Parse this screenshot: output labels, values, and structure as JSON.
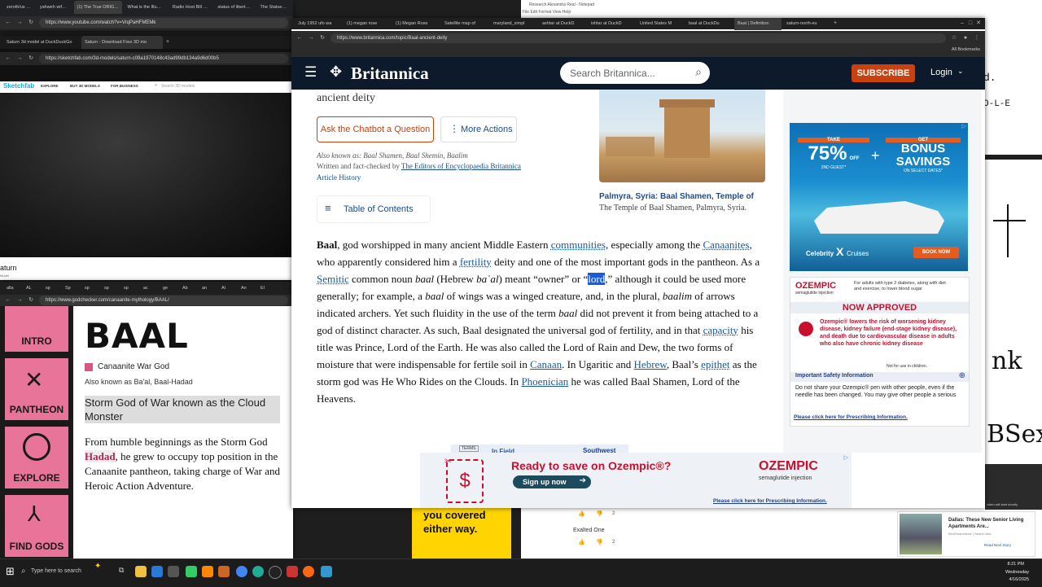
{
  "yt": {
    "tabs": [
      "zeroth/us - YouTube",
      "yahweh wife - YouTube",
      "(1) The True ORIGIN of God",
      "What is the Illuminati? Expo",
      "Radio Host Bill Cooper Pred",
      "status of liberty given by fre",
      "The Statue of Liberty and"
    ],
    "url": "https://www.youtube.com/watch?v=VrqPaHFMEMk"
  },
  "notepad": {
    "title": "Research Alexandra Real - Notepad",
    "menu": "File  Edit  Format  View  Help",
    "right_text": [
      "d.",
      "O-L-E"
    ]
  },
  "sf": {
    "tabs": [
      "Saturn 3d model at DuckDuckGo",
      "Saturn - Download Free 3D mo"
    ],
    "url": "https://sketchfab.com/3d-models/saturn-c09a1970148c43ad99db134a9d6d00b5",
    "logo": "Sketchfab",
    "nav": [
      "EXPLORE",
      "BUY 3D MODELS",
      "FOR BUSINESS"
    ],
    "search_placeholder": "Search 3D models",
    "title": "aturn",
    "subtitle": "Model"
  },
  "gc": {
    "tabs": [
      "alla",
      "AL",
      "sp",
      "Sp",
      "sp",
      "sp",
      "sp",
      "ac",
      "ge",
      "Ab",
      "an",
      "Al",
      "An",
      "El"
    ],
    "url": "https://www.godchecker.com/canaanite-mythology/BAAL/",
    "side": [
      "INTRO",
      "PANTHEON",
      "EXPLORE",
      "FIND GODS"
    ],
    "heading": "BAAL",
    "category": "Canaanite War God",
    "aka": "Also known as Ba'al, Baal-Hadad",
    "tagline": "Storm God of War known as the Cloud Monster",
    "body_pre": "From humble beginnings as the Storm God",
    "body_link": "Hadad",
    "body_post": ", he grew to occupy top position in the Canaanite pantheon, taking charge of War and Heroic Action Adventure."
  },
  "br": {
    "tabs": [
      "July 1952 ufo wa",
      "(1) megan rose",
      "(1) Megan Rose",
      "Satellite map of",
      "maryland_simpl",
      "ashtar at DuckD",
      "ishtar at DuckD",
      "United States M",
      "baal at DuckDu",
      "Baal | Definition",
      "saturn-north-eu"
    ],
    "url": "https://www.britannica.com/topic/Baal-ancient-deity",
    "bookmarks": "All Bookmarks",
    "logo": "Britannica",
    "search_placeholder": "Search Britannica...",
    "subscribe": "SUBSCRIBE",
    "login": "Login",
    "subtitle": "ancient deity",
    "chatbot": "Ask the Chatbot a Question",
    "more": "More Actions",
    "aka": "Also known as: Baal Shamen, Baal Shemin, Baalim",
    "written": "Written and fact-checked by ",
    "editors": "The Editors of Encyclopaedia Britannica",
    "history": "Article History",
    "toc": "Table of Contents",
    "caption_title": "Palmyra, Syria: Baal Shamen, Temple of",
    "caption_text": "The Temple of Baal Shamen, Palmyra, Syria.",
    "ad_terms": "TERMS",
    "ad_infield": "In Field",
    "ad_southwest": "Southwest"
  },
  "ad1": {
    "take": "TAKE",
    "pct": "75%",
    "off": "OFF",
    "guest": "2ND GUEST*",
    "get": "GET",
    "bonus": "BONUS",
    "savings": "SAVINGS",
    "select": "ON SELECT DATES*",
    "brand": "Celebrity",
    "cruises": "Cruises",
    "book": "BOOK NOW"
  },
  "ad2": {
    "brand": "OZEMPIC",
    "sub": "semaglutide injection",
    "blurb": "For adults with type 2 diabetes, along with diet and exercise, to lower blood sugar",
    "approved": "NOW APPROVED",
    "risk": "Ozempic® lowers the risk of worsening kidney disease, kidney failure (end-stage kidney disease), and death due to cardiovascular disease in adults who also have chronic kidney disease",
    "not_children": "Not for use in children.",
    "safety": "Important Safety Information",
    "safety_text": "Do not share your Ozempic® pen with other people, even if the needle has been changed. You may give other people a serious",
    "prescribing": "Please click here for Prescribing Information."
  },
  "ad3": {
    "headline": "Ready to save on Ozempic®?",
    "signup": "Sign up now",
    "brand": "OZEMPIC",
    "sub": "semaglutide injection",
    "prescribing": "Please click here for Prescribing Information."
  },
  "bg": {
    "covered": "you covered either way.",
    "exalted": "Exalted One",
    "count1": "2",
    "count2": "2",
    "news_title": "Dallas: These New Senior Living Apartments Are...",
    "news_src": "BestSearchNow | Search Ads",
    "news_read": "Read Next Story",
    "right_marks": [
      "BSex",
      "nk",
      "video will start shortly"
    ]
  },
  "taskbar": {
    "search": "Type here to search",
    "time": "8:21 PM",
    "day": "Wednesday",
    "date": "4/16/2025"
  }
}
